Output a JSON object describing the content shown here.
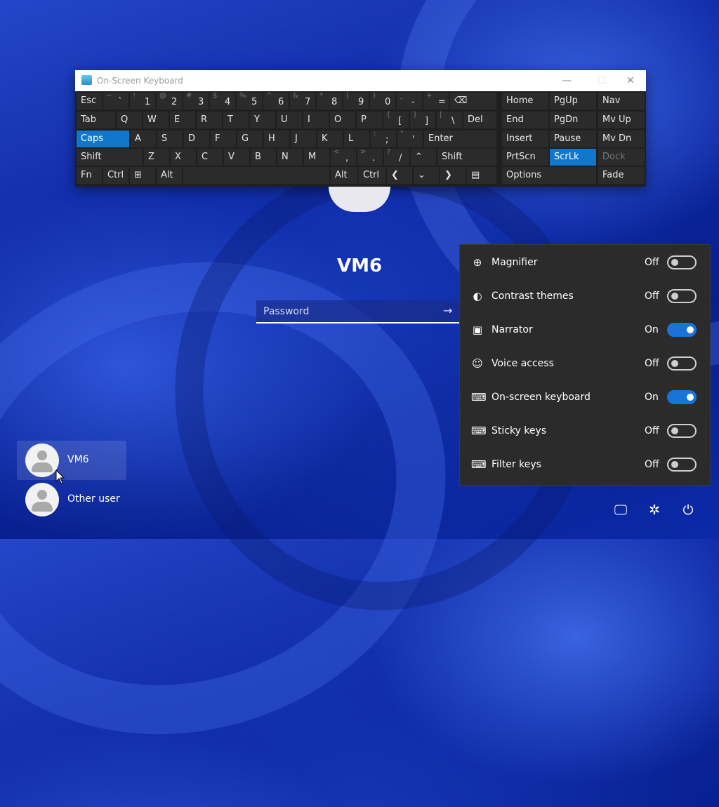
{
  "osk": {
    "title": "On-Screen Keyboard",
    "controls": {
      "minimize": "—",
      "maximize": "☐",
      "close": "✕"
    },
    "row1": [
      {
        "m": "Esc"
      },
      {
        "s": "~",
        "b": "`"
      },
      {
        "s": "!",
        "b": "1"
      },
      {
        "s": "@",
        "b": "2"
      },
      {
        "s": "#",
        "b": "3"
      },
      {
        "s": "$",
        "b": "4"
      },
      {
        "s": "%",
        "b": "5"
      },
      {
        "s": "^",
        "b": "6"
      },
      {
        "s": "&",
        "b": "7"
      },
      {
        "s": "*",
        "b": "8"
      },
      {
        "s": "(",
        "b": "9"
      },
      {
        "s": ")",
        "b": "0"
      },
      {
        "s": "_",
        "b": "-"
      },
      {
        "s": "+",
        "b": "="
      },
      {
        "m": "⌫"
      }
    ],
    "row2": [
      {
        "m": "Tab"
      },
      {
        "m": "Q"
      },
      {
        "m": "W"
      },
      {
        "m": "E"
      },
      {
        "m": "R"
      },
      {
        "m": "T"
      },
      {
        "m": "Y"
      },
      {
        "m": "U"
      },
      {
        "m": "I"
      },
      {
        "m": "O"
      },
      {
        "m": "P"
      },
      {
        "s": "{",
        "b": "["
      },
      {
        "s": "}",
        "b": "]"
      },
      {
        "s": "|",
        "b": "\\"
      },
      {
        "m": "Del"
      }
    ],
    "row3": [
      {
        "m": "Caps"
      },
      {
        "m": "A"
      },
      {
        "m": "S"
      },
      {
        "m": "D"
      },
      {
        "m": "F"
      },
      {
        "m": "G"
      },
      {
        "m": "H"
      },
      {
        "m": "J"
      },
      {
        "m": "K"
      },
      {
        "m": "L"
      },
      {
        "s": ":",
        "b": ";"
      },
      {
        "s": "\"",
        "b": "'"
      },
      {
        "m": "Enter"
      }
    ],
    "row4": [
      {
        "m": "Shift"
      },
      {
        "m": "Z"
      },
      {
        "m": "X"
      },
      {
        "m": "C"
      },
      {
        "m": "V"
      },
      {
        "m": "B"
      },
      {
        "m": "N"
      },
      {
        "m": "M"
      },
      {
        "s": "<",
        "b": ","
      },
      {
        "s": ">",
        "b": "."
      },
      {
        "s": "?",
        "b": "/"
      },
      {
        "m": "⌃"
      },
      {
        "m": "Shift"
      }
    ],
    "row5": [
      {
        "m": "Fn"
      },
      {
        "m": "Ctrl"
      },
      {
        "m": "⊞"
      },
      {
        "m": "Alt"
      },
      {
        "m": ""
      },
      {
        "m": "Alt"
      },
      {
        "m": "Ctrl"
      },
      {
        "m": "❮"
      },
      {
        "m": "⌄"
      },
      {
        "m": "❯"
      },
      {
        "m": "▤"
      }
    ],
    "nav": [
      [
        "Home",
        "PgUp",
        "Nav"
      ],
      [
        "End",
        "PgDn",
        "Mv Up"
      ],
      [
        "Insert",
        "Pause",
        "Mv Dn"
      ],
      [
        "PrtScn",
        "ScrLk",
        "Dock"
      ],
      [
        "Options",
        "",
        "Fade"
      ]
    ]
  },
  "login": {
    "username": "VM6",
    "password_placeholder": "Password",
    "submit_icon": "arrow-right-icon"
  },
  "users": [
    {
      "name": "VM6",
      "selected": true
    },
    {
      "name": "Other user",
      "selected": false
    }
  ],
  "accessibility": {
    "items": [
      {
        "label": "Magnifier",
        "state": "Off",
        "on": false,
        "icon": "magnifier-icon",
        "glyph": "⊕"
      },
      {
        "label": "Contrast themes",
        "state": "Off",
        "on": false,
        "icon": "contrast-icon",
        "glyph": "◐"
      },
      {
        "label": "Narrator",
        "state": "On",
        "on": true,
        "icon": "narrator-icon",
        "glyph": "▣"
      },
      {
        "label": "Voice access",
        "state": "Off",
        "on": false,
        "icon": "voice-access-icon",
        "glyph": "☺"
      },
      {
        "label": "On-screen keyboard",
        "state": "On",
        "on": true,
        "icon": "keyboard-icon",
        "glyph": "⌨"
      },
      {
        "label": "Sticky keys",
        "state": "Off",
        "on": false,
        "icon": "sticky-keys-icon",
        "glyph": "⌨"
      },
      {
        "label": "Filter keys",
        "state": "Off",
        "on": false,
        "icon": "filter-keys-icon",
        "glyph": "⌨"
      }
    ]
  },
  "bottom_icons": [
    {
      "name": "network-icon",
      "glyph": "🖵"
    },
    {
      "name": "accessibility-icon",
      "glyph": "✲"
    },
    {
      "name": "power-icon",
      "glyph": "⏻"
    }
  ],
  "colors": {
    "accent": "#1a73d9",
    "osk_highlight": "#1177cc",
    "panel_bg": "#2b2b2b"
  }
}
